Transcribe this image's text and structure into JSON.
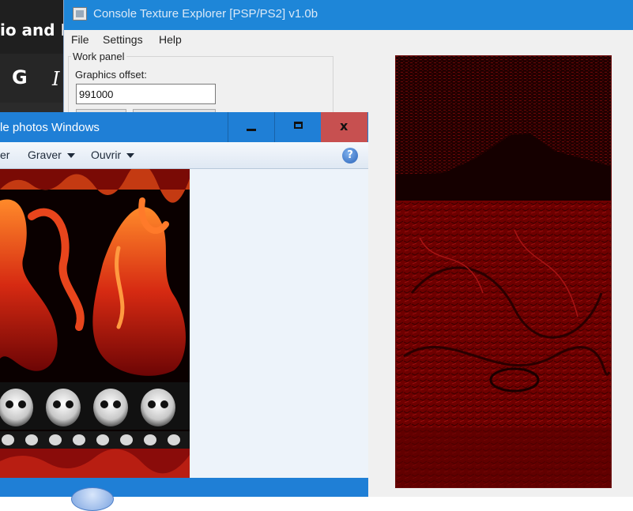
{
  "background_app": {
    "title_fragment": "io and M",
    "bold_button": "G",
    "italic_button": "I"
  },
  "cte_window": {
    "title": "Console Texture Explorer [PSP/PS2] v1.0b",
    "menu": [
      "File",
      "Settings",
      "Help"
    ],
    "work_panel_label": "Work panel",
    "graphics_offset_label": "Graphics offset:",
    "graphics_offset_value": "991000"
  },
  "photo_viewer": {
    "title": "le photos Windows",
    "toolbar": {
      "item_cut": "er",
      "burn": "Graver",
      "open": "Ouvrir"
    },
    "help_icon": "help-icon",
    "close_glyph": "x"
  },
  "colors": {
    "titlebar_blue": "#1e86d8",
    "close_red": "#c75050",
    "texture_red": "#6b0000"
  }
}
